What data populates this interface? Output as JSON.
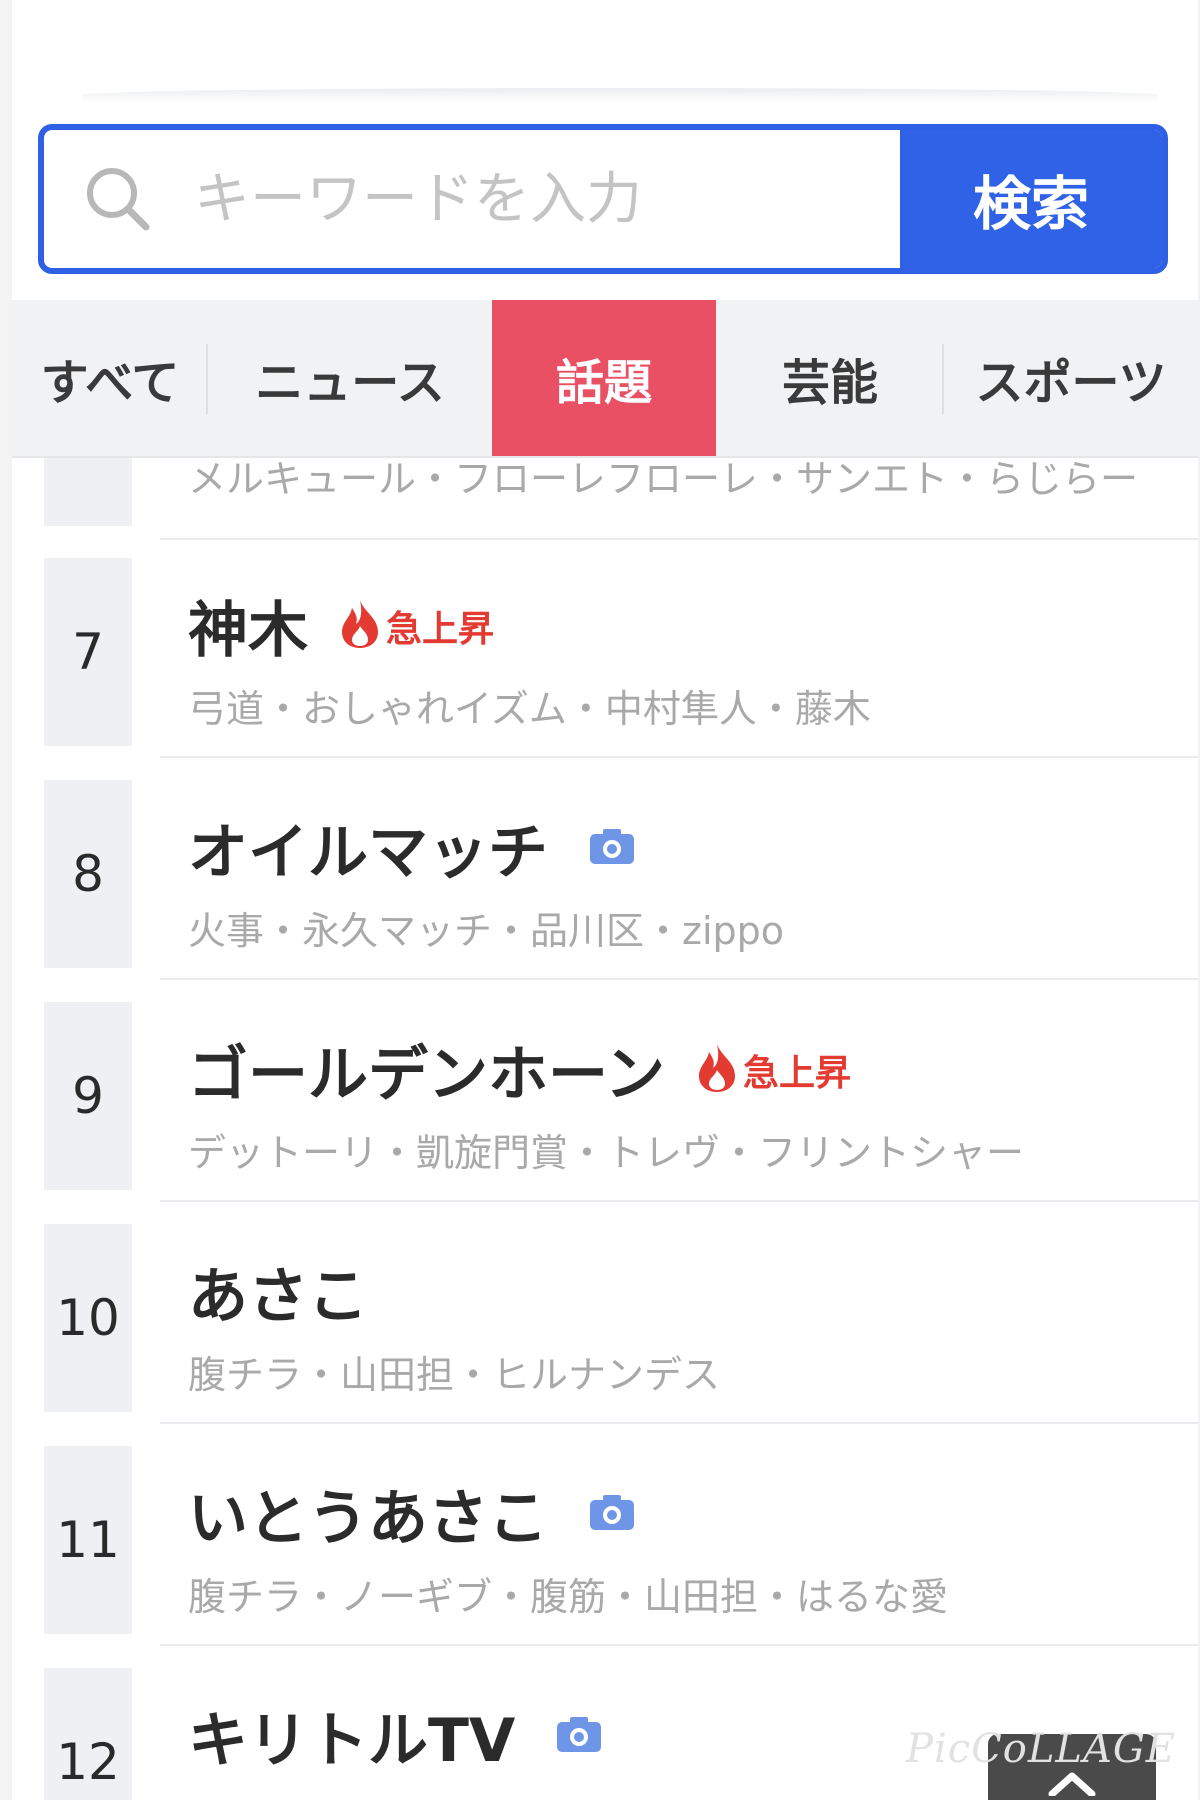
{
  "search": {
    "placeholder": "キーワードを入力",
    "button_label": "検索"
  },
  "tabs": [
    {
      "label": "すべて"
    },
    {
      "label": "ニュース"
    },
    {
      "label": "話題",
      "active": true
    },
    {
      "label": "芸能"
    },
    {
      "label": "スポーツ"
    }
  ],
  "partial_row": {
    "related": "メルキュール・フローレフローレ・サンエト・らじらー"
  },
  "rows": [
    {
      "rank": "7",
      "title": "神木",
      "badge": "急上昇",
      "related": "弓道・おしゃれイズム・中村隼人・藤木"
    },
    {
      "rank": "8",
      "title": "オイルマッチ",
      "icon": "camera-icon",
      "related": "火事・永久マッチ・品川区・zippo"
    },
    {
      "rank": "9",
      "title": "ゴールデンホーン",
      "badge": "急上昇",
      "related": "デットーリ・凱旋門賞・トレヴ・フリントシャー"
    },
    {
      "rank": "10",
      "title": "あさこ",
      "related": "腹チラ・山田担・ヒルナンデス"
    },
    {
      "rank": "11",
      "title": "いとうあさこ",
      "icon": "camera-icon",
      "related": "腹チラ・ノーギブ・腹筋・山田担・はるな愛"
    },
    {
      "rank": "12",
      "title": "キリトルTV",
      "icon": "camera-icon",
      "related": ""
    }
  ],
  "watermark": "PicCoLLAGE",
  "colors": {
    "accent_blue": "#2f62e6",
    "active_tab": "#ea5064",
    "hot_red": "#e33a32",
    "camera_blue": "#6f96e6"
  }
}
